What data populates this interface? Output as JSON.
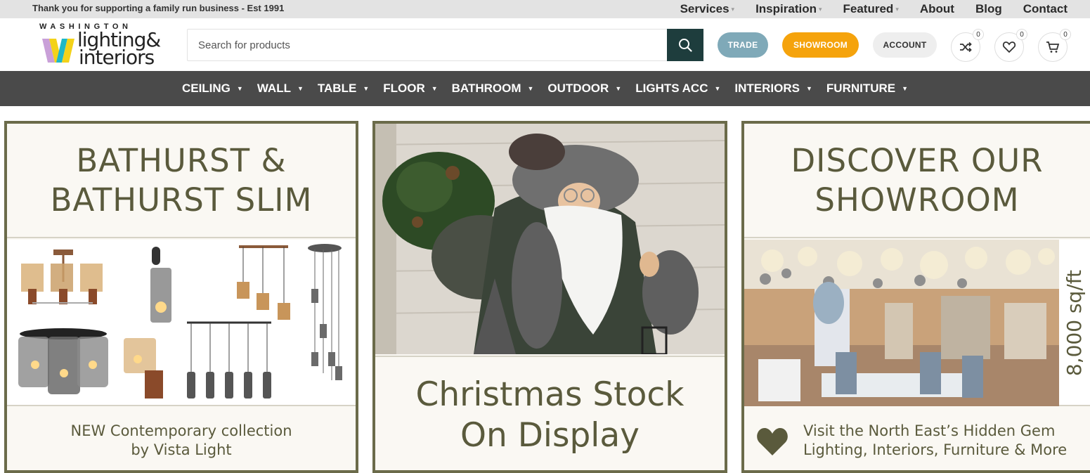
{
  "topbar": {
    "tagline": "Thank you for supporting a family run business - Est 1991",
    "nav": [
      {
        "label": "Services",
        "has_dropdown": true
      },
      {
        "label": "Inspiration",
        "has_dropdown": true
      },
      {
        "label": "Featured",
        "has_dropdown": true
      },
      {
        "label": "About",
        "has_dropdown": false
      },
      {
        "label": "Blog",
        "has_dropdown": false
      },
      {
        "label": "Contact",
        "has_dropdown": false
      }
    ]
  },
  "logo": {
    "top": "WASHINGTON",
    "line1": "lighting&",
    "line2": "interiors"
  },
  "search": {
    "placeholder": "Search for products",
    "value": ""
  },
  "header_buttons": {
    "trade": "TRADE",
    "showroom": "SHOWROOM",
    "account": "ACCOUNT"
  },
  "header_icons": {
    "compare_count": "0",
    "wishlist_count": "0",
    "cart_count": "0"
  },
  "main_nav": [
    {
      "label": "CEILING"
    },
    {
      "label": "WALL"
    },
    {
      "label": "TABLE"
    },
    {
      "label": "FLOOR"
    },
    {
      "label": "BATHROOM"
    },
    {
      "label": "OUTDOOR"
    },
    {
      "label": "LIGHTS ACC"
    },
    {
      "label": "INTERIORS"
    },
    {
      "label": "FURNITURE"
    }
  ],
  "panels": {
    "bathurst": {
      "title_line1": "BATHURST &",
      "title_line2": "BATHURST SLIM",
      "subtitle_line1": "NEW Contemporary collection",
      "subtitle_line2": "by Vista Light"
    },
    "christmas": {
      "title_line1": "Christmas Stock",
      "title_line2": "On Display"
    },
    "showroom": {
      "title_line1": "DISCOVER OUR",
      "title_line2": "SHOWROOM",
      "area": "8,000 sq/ft",
      "subtitle_line1": "Visit the North East’s Hidden Gem",
      "subtitle_line2": "Lighting, Interiors, Furniture & More"
    }
  },
  "colors": {
    "accent_dark": "#1e3d3d",
    "trade": "#7fa9b8",
    "showroom": "#f5a30c",
    "nav_bg": "#4a4a4a",
    "panel_border": "#6b6b4a",
    "panel_text": "#5a5a3c"
  }
}
